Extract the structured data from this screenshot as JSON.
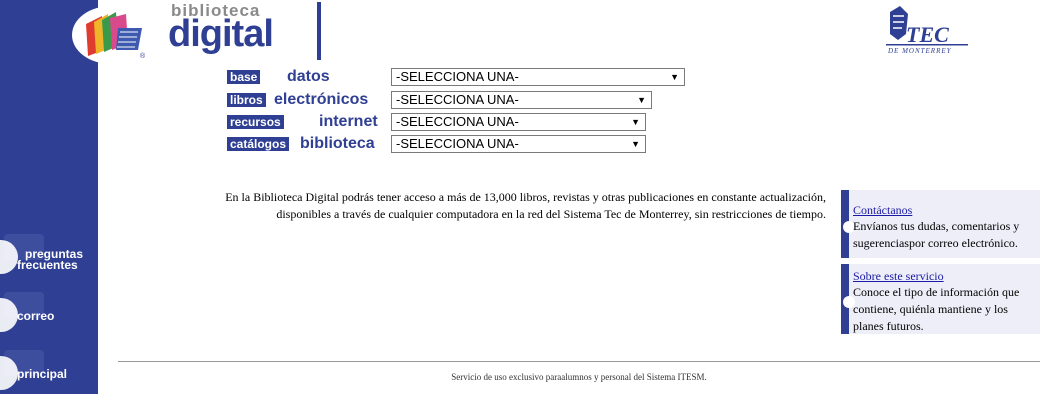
{
  "header": {
    "brand_small": "biblioteca",
    "brand_big": "digital",
    "tec_logo_text": "TEC",
    "tec_logo_sub": "DE MONTERREY"
  },
  "sidebar": {
    "items": [
      {
        "label_line1": "preguntas",
        "label_line2": "frecuentes"
      },
      {
        "label_line1": "correo",
        "label_line2": ""
      },
      {
        "label_line1": "principal",
        "label_line2": ""
      }
    ]
  },
  "selectors": [
    {
      "tag": "base de",
      "word": "datos",
      "value": "-SELECCIONA UNA-"
    },
    {
      "tag": "libros",
      "word": "electrónicos",
      "value": "-SELECCIONA UNA-"
    },
    {
      "tag": "recursos de",
      "word": "internet",
      "value": "-SELECCIONA UNA-"
    },
    {
      "tag": "catálogos",
      "word": "biblioteca",
      "value": "-SELECCIONA UNA-"
    }
  ],
  "description": {
    "line1": "En la Biblioteca Digital podrás tener acceso a más de 13,000 libros, revistas y otras publicaciones en constante actualización,",
    "line2": "disponibles a través de cualquier computadora en la red del Sistema Tec de Monterrey, sin restricciones de tiempo."
  },
  "info_boxes": [
    {
      "link": "Contáctanos",
      "text": "Envíanos tus dudas, comentarios y sugerenciaspor correo electrónico."
    },
    {
      "link": "Sobre este servicio",
      "text": "Conoce el tipo de información que contiene, quiénla mantiene y los planes futuros."
    }
  ],
  "footer": {
    "text": "Servicio de uso exclusivo paraalumnos y personal del Sistema ITESM."
  },
  "colors": {
    "brand_blue": "#2f3f93",
    "brand_gray": "#8a8a8a",
    "info_bg": "#eeeef8",
    "link": "#1a1aa6"
  },
  "icons": [
    "open-book-logo-icon",
    "tec-de-monterrey-logo-icon",
    "dropdown-arrow-icon"
  ]
}
